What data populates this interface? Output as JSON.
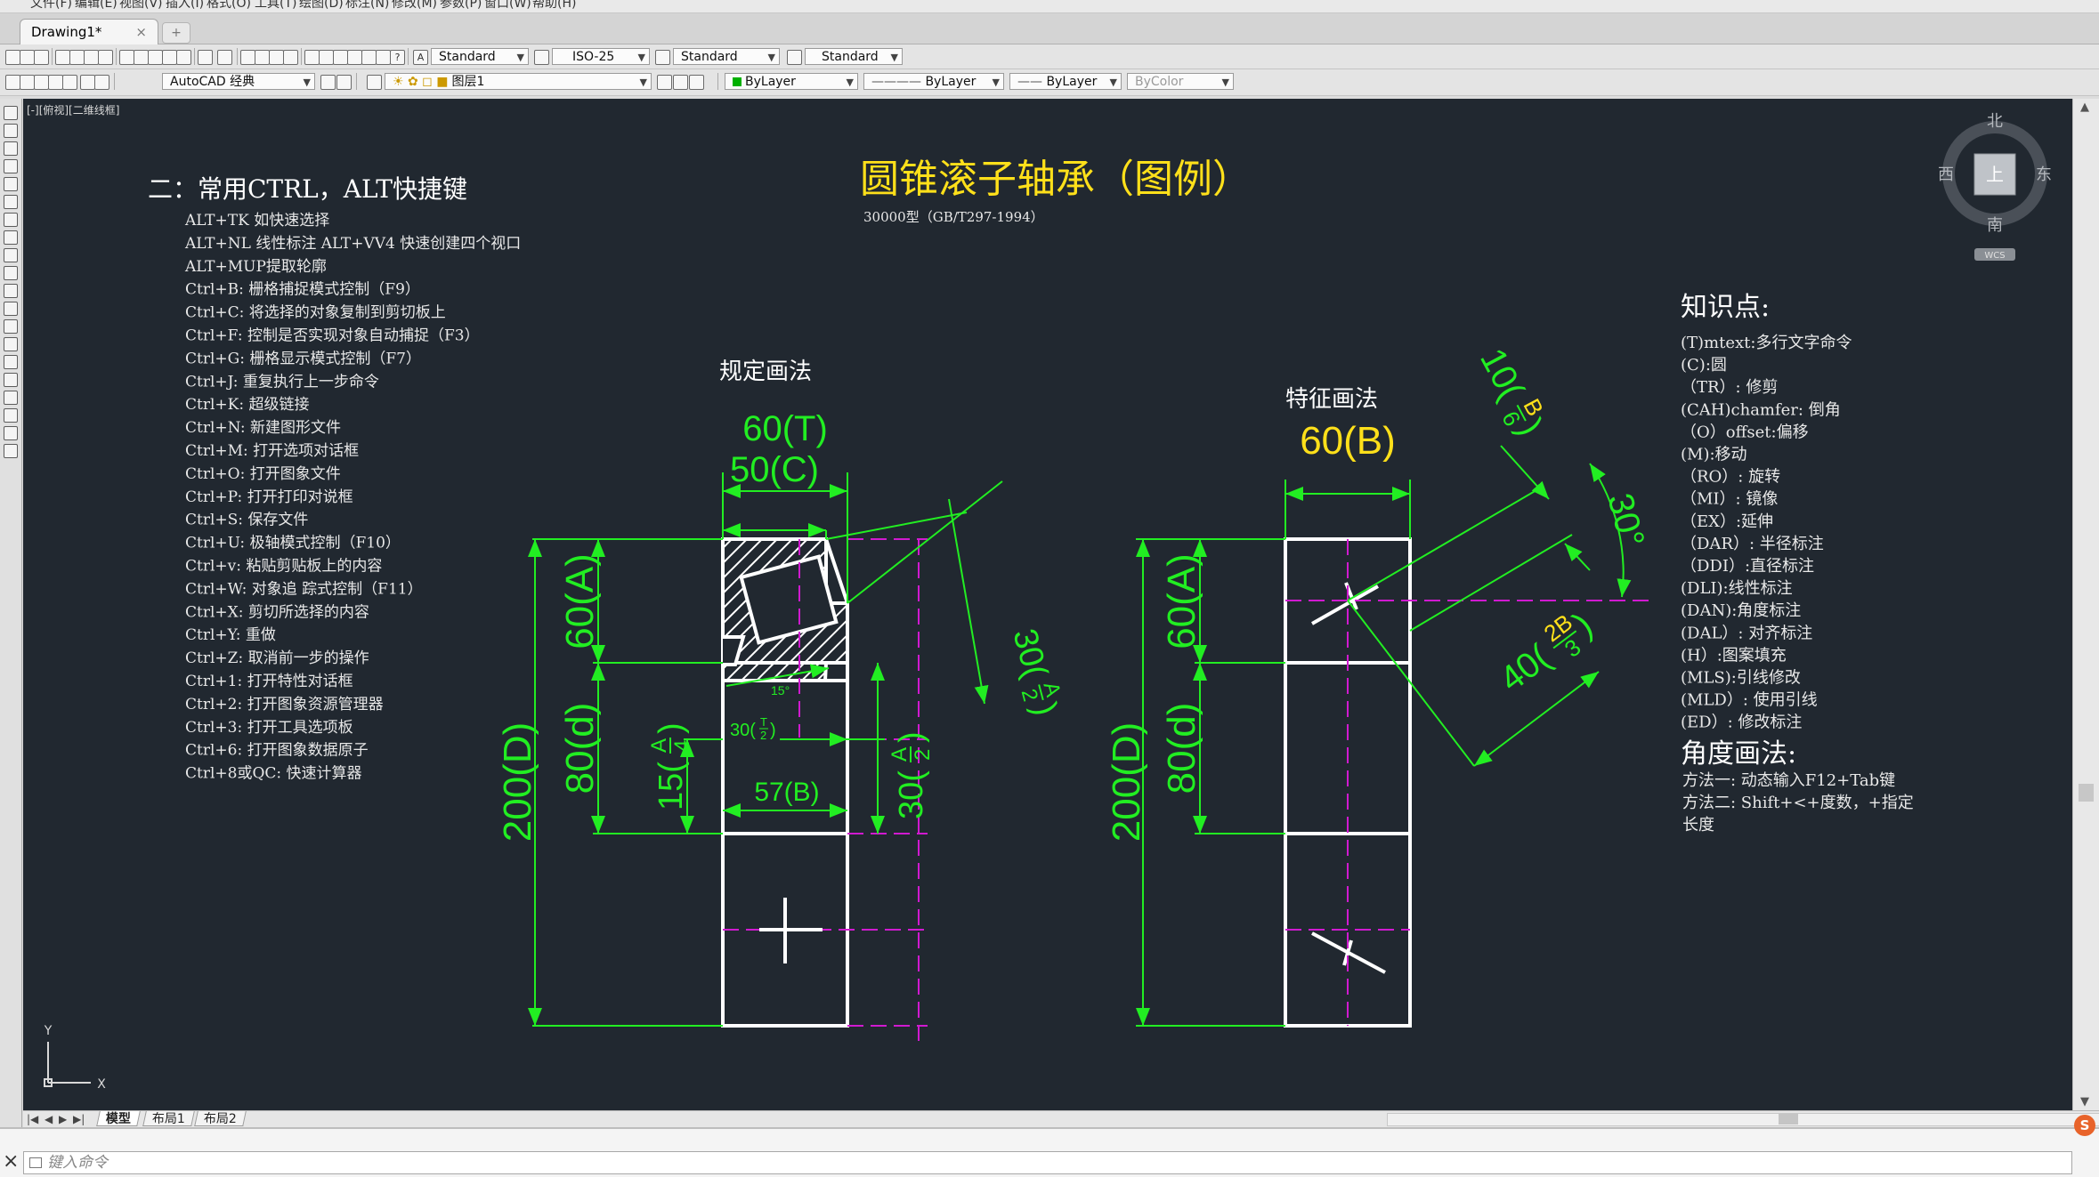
{
  "menu": [
    "文件(F)",
    "编辑(E)",
    "视图(V)",
    "插入(I)",
    "格式(O)",
    "工具(T)",
    "绘图(D)",
    "标注(N)",
    "修改(M)",
    "参数(P)",
    "窗口(W)",
    "帮助(H)"
  ],
  "document_tab": {
    "title": "Drawing1*",
    "close": "×"
  },
  "toolbar1": {
    "text_style": "Standard",
    "dim_style": "ISO-25",
    "table_style": "Standard",
    "mleader_style": "Standard"
  },
  "toolbar2": {
    "workspace": "AutoCAD 经典",
    "layer": "图层1",
    "color": "ByLayer",
    "linetype": "ByLayer",
    "lineweight": "ByLayer",
    "plotstyle": "ByColor"
  },
  "viewport_label": "[-][俯视][二维线框]",
  "viewcube": {
    "north": "北",
    "south": "南",
    "east": "东",
    "west": "西",
    "top": "上",
    "wcs": "WCS"
  },
  "title": "圆锥滚子轴承（图例）",
  "subtitle": "30000型（GB/T297-1994）",
  "shortcuts": {
    "heading": "二：常用CTRL，ALT快捷键",
    "items": [
      "ALT+TK 如快速选择",
      "ALT+NL 线性标注 ALT+VV4 快速创建四个视口",
      "ALT+MUP提取轮廓",
      "Ctrl+B: 栅格捕捉模式控制（F9）",
      "Ctrl+C: 将选择的对象复制到剪切板上",
      "Ctrl+F: 控制是否实现对象自动捕捉（F3）",
      "Ctrl+G: 栅格显示模式控制（F7）",
      "Ctrl+J: 重复执行上一步命令",
      "Ctrl+K: 超级链接",
      "Ctrl+N: 新建图形文件",
      "Ctrl+M: 打开选项对话框",
      "Ctrl+O: 打开图象文件",
      "Ctrl+P: 打开打印对说框",
      "Ctrl+S: 保存文件",
      "Ctrl+U: 极轴模式控制（F10）",
      "Ctrl+v: 粘贴剪贴板上的内容",
      "Ctrl+W: 对象追 踪式控制（F11）",
      "Ctrl+X: 剪切所选择的内容",
      "Ctrl+Y: 重做",
      "Ctrl+Z: 取消前一步的操作",
      "Ctrl+1: 打开特性对话框",
      "Ctrl+2: 打开图象资源管理器",
      "Ctrl+3: 打开工具选项板",
      "Ctrl+6: 打开图象数据原子",
      "Ctrl+8或QC: 快速计算器"
    ]
  },
  "knowledge": {
    "heading": "知识点:",
    "items": [
      "(T)mtext:多行文字命令",
      "(C):圆",
      "（TR）: 修剪",
      "(CAH)chamfer: 倒角",
      "（O）offset:偏移",
      "(M):移动",
      "（RO）: 旋转",
      "（MI）: 镜像",
      "（EX）:延伸",
      "（DAR）: 半径标注",
      "（DDI）:直径标注",
      "(DLI):线性标注",
      "(DAN):角度标注",
      "(DAL）: 对齐标注",
      "(H）:图案填充",
      "(MLS):引线修改",
      "(MLD）: 使用引线",
      "(ED）: 修改标注"
    ],
    "angle_heading": "角度画法:",
    "angle_items": [
      "方法一: 动态输入F12+Tab键",
      "方法二: Shift+<+度数，+指定",
      "长度"
    ]
  },
  "left_drawing": {
    "label": "规定画法",
    "dim_T": "60(T)",
    "dim_C": "50(C)",
    "dim_D": "200(D)",
    "dim_d": "80(d)",
    "dim_A": "60(A)",
    "dim_B": "57(B)",
    "dim_A4_pre": "15(",
    "dim_A4_num": "A",
    "dim_A4_den": "4",
    "dim_A2_pre": "30(",
    "dim_A2_num": "A",
    "dim_A2_den": "2",
    "dim_T2_pre": "30(",
    "dim_T2_num": "T",
    "dim_T2_den": "2",
    "angle_15": "15°",
    "dim_A2_slant": "30(A/2)"
  },
  "right_drawing": {
    "label": "特征画法",
    "dim_B": "60(B)",
    "dim_D": "200(D)",
    "dim_d": "80(d)",
    "dim_A": "60(A)",
    "dim_B6": "10(B/6)",
    "dim_2B3": "40(2B/3)",
    "angle_30": "30°"
  },
  "axes": {
    "x": "X",
    "y": "Y"
  },
  "layout_tabs": [
    "模型",
    "布局1",
    "布局2"
  ],
  "command_prompt": "键入命令",
  "colors": {
    "canvas": "#212830",
    "title": "#ffe01a",
    "dim": "#22ee22",
    "geometry": "#ffffff",
    "hidden": "#d01ad0",
    "text": "#e8e8e8"
  }
}
